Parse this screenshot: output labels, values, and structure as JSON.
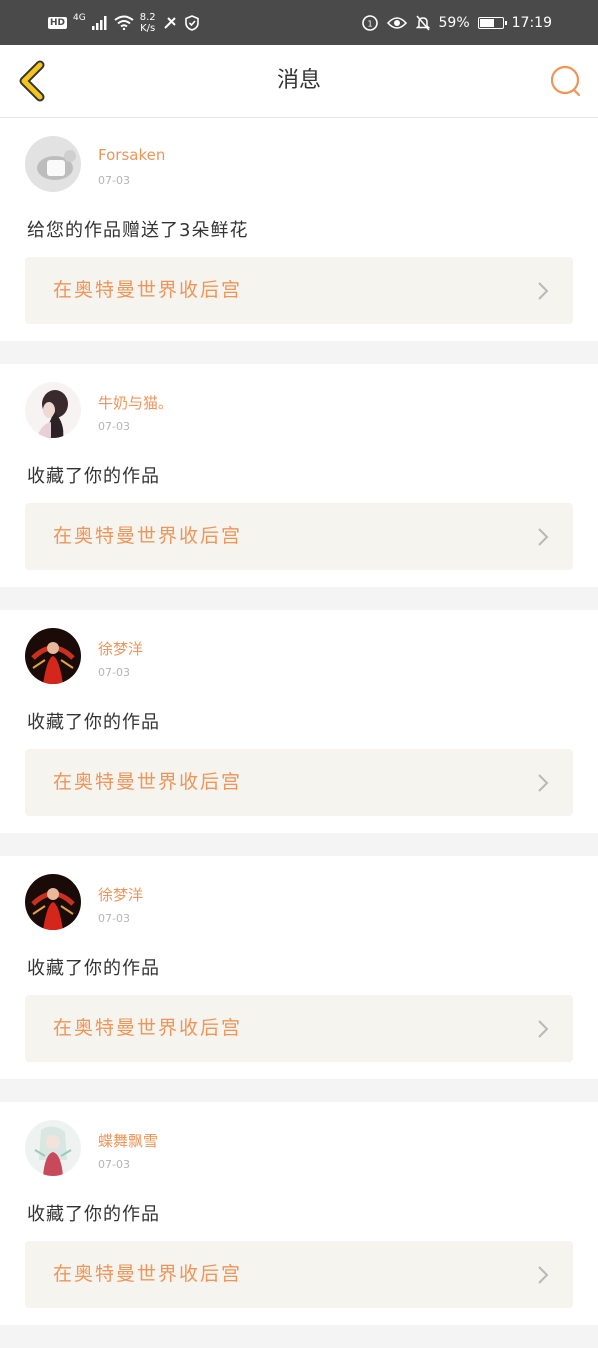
{
  "status_bar": {
    "hd": "HD",
    "network": "4G",
    "speed_value": "8.2",
    "speed_unit": "K/s",
    "battery_percent": "59%",
    "battery_level": 0.59,
    "time": "17:19"
  },
  "nav": {
    "title": "消息",
    "back_icon": "chevron-left-icon",
    "search_icon": "search-icon"
  },
  "messages": [
    {
      "user": "Forsaken",
      "date": "07-03",
      "action": "给您的作品赠送了3朵鲜花",
      "work": "在奥特曼世界收后宫"
    },
    {
      "user": "牛奶与猫。",
      "date": "07-03",
      "action": "收藏了你的作品",
      "work": "在奥特曼世界收后宫"
    },
    {
      "user": "徐梦洋",
      "date": "07-03",
      "action": "收藏了你的作品",
      "work": "在奥特曼世界收后宫"
    },
    {
      "user": "徐梦洋",
      "date": "07-03",
      "action": "收藏了你的作品",
      "work": "在奥特曼世界收后宫"
    },
    {
      "user": "蝶舞飘雪",
      "date": "07-03",
      "action": "收藏了你的作品",
      "work": "在奥特曼世界收后宫"
    }
  ],
  "colors": {
    "accent": "#f0955a",
    "back_icon": "#f5c518",
    "status_bar_bg": "#4a4a4a"
  }
}
